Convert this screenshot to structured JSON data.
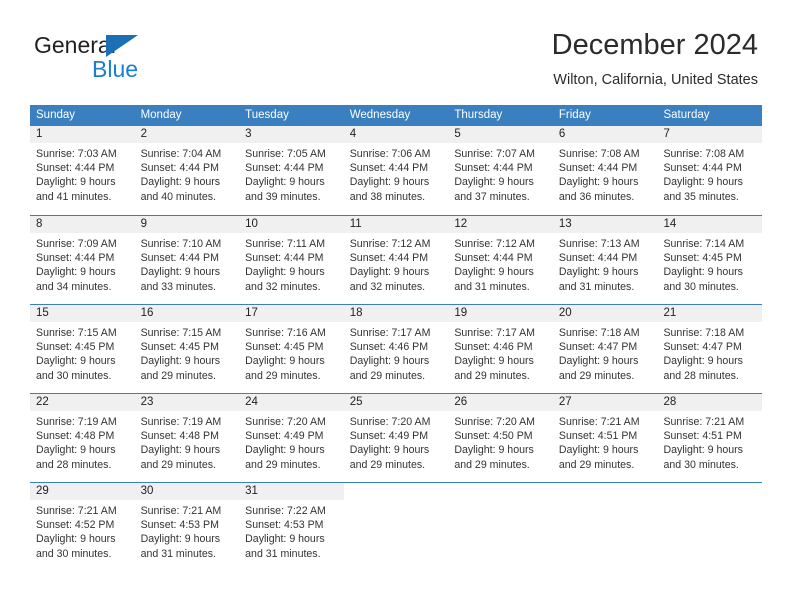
{
  "logo": {
    "word_one": "General",
    "word_two": "Blue",
    "triangle_icon": "blue-triangle-icon",
    "brand_color": "#1a7fd4"
  },
  "header": {
    "title": "December 2024",
    "subtitle": "Wilton, California, United States"
  },
  "calendar": {
    "header_color": "#3a7fbf",
    "weekdays": [
      "Sunday",
      "Monday",
      "Tuesday",
      "Wednesday",
      "Thursday",
      "Friday",
      "Saturday"
    ],
    "weeks": [
      [
        {
          "day": "1",
          "sunrise": "Sunrise: 7:03 AM",
          "sunset": "Sunset: 4:44 PM",
          "daylight_1": "Daylight: 9 hours",
          "daylight_2": "and 41 minutes."
        },
        {
          "day": "2",
          "sunrise": "Sunrise: 7:04 AM",
          "sunset": "Sunset: 4:44 PM",
          "daylight_1": "Daylight: 9 hours",
          "daylight_2": "and 40 minutes."
        },
        {
          "day": "3",
          "sunrise": "Sunrise: 7:05 AM",
          "sunset": "Sunset: 4:44 PM",
          "daylight_1": "Daylight: 9 hours",
          "daylight_2": "and 39 minutes."
        },
        {
          "day": "4",
          "sunrise": "Sunrise: 7:06 AM",
          "sunset": "Sunset: 4:44 PM",
          "daylight_1": "Daylight: 9 hours",
          "daylight_2": "and 38 minutes."
        },
        {
          "day": "5",
          "sunrise": "Sunrise: 7:07 AM",
          "sunset": "Sunset: 4:44 PM",
          "daylight_1": "Daylight: 9 hours",
          "daylight_2": "and 37 minutes."
        },
        {
          "day": "6",
          "sunrise": "Sunrise: 7:08 AM",
          "sunset": "Sunset: 4:44 PM",
          "daylight_1": "Daylight: 9 hours",
          "daylight_2": "and 36 minutes."
        },
        {
          "day": "7",
          "sunrise": "Sunrise: 7:08 AM",
          "sunset": "Sunset: 4:44 PM",
          "daylight_1": "Daylight: 9 hours",
          "daylight_2": "and 35 minutes."
        }
      ],
      [
        {
          "day": "8",
          "sunrise": "Sunrise: 7:09 AM",
          "sunset": "Sunset: 4:44 PM",
          "daylight_1": "Daylight: 9 hours",
          "daylight_2": "and 34 minutes."
        },
        {
          "day": "9",
          "sunrise": "Sunrise: 7:10 AM",
          "sunset": "Sunset: 4:44 PM",
          "daylight_1": "Daylight: 9 hours",
          "daylight_2": "and 33 minutes."
        },
        {
          "day": "10",
          "sunrise": "Sunrise: 7:11 AM",
          "sunset": "Sunset: 4:44 PM",
          "daylight_1": "Daylight: 9 hours",
          "daylight_2": "and 32 minutes."
        },
        {
          "day": "11",
          "sunrise": "Sunrise: 7:12 AM",
          "sunset": "Sunset: 4:44 PM",
          "daylight_1": "Daylight: 9 hours",
          "daylight_2": "and 32 minutes."
        },
        {
          "day": "12",
          "sunrise": "Sunrise: 7:12 AM",
          "sunset": "Sunset: 4:44 PM",
          "daylight_1": "Daylight: 9 hours",
          "daylight_2": "and 31 minutes."
        },
        {
          "day": "13",
          "sunrise": "Sunrise: 7:13 AM",
          "sunset": "Sunset: 4:44 PM",
          "daylight_1": "Daylight: 9 hours",
          "daylight_2": "and 31 minutes."
        },
        {
          "day": "14",
          "sunrise": "Sunrise: 7:14 AM",
          "sunset": "Sunset: 4:45 PM",
          "daylight_1": "Daylight: 9 hours",
          "daylight_2": "and 30 minutes."
        }
      ],
      [
        {
          "day": "15",
          "sunrise": "Sunrise: 7:15 AM",
          "sunset": "Sunset: 4:45 PM",
          "daylight_1": "Daylight: 9 hours",
          "daylight_2": "and 30 minutes."
        },
        {
          "day": "16",
          "sunrise": "Sunrise: 7:15 AM",
          "sunset": "Sunset: 4:45 PM",
          "daylight_1": "Daylight: 9 hours",
          "daylight_2": "and 29 minutes."
        },
        {
          "day": "17",
          "sunrise": "Sunrise: 7:16 AM",
          "sunset": "Sunset: 4:45 PM",
          "daylight_1": "Daylight: 9 hours",
          "daylight_2": "and 29 minutes."
        },
        {
          "day": "18",
          "sunrise": "Sunrise: 7:17 AM",
          "sunset": "Sunset: 4:46 PM",
          "daylight_1": "Daylight: 9 hours",
          "daylight_2": "and 29 minutes."
        },
        {
          "day": "19",
          "sunrise": "Sunrise: 7:17 AM",
          "sunset": "Sunset: 4:46 PM",
          "daylight_1": "Daylight: 9 hours",
          "daylight_2": "and 29 minutes."
        },
        {
          "day": "20",
          "sunrise": "Sunrise: 7:18 AM",
          "sunset": "Sunset: 4:47 PM",
          "daylight_1": "Daylight: 9 hours",
          "daylight_2": "and 29 minutes."
        },
        {
          "day": "21",
          "sunrise": "Sunrise: 7:18 AM",
          "sunset": "Sunset: 4:47 PM",
          "daylight_1": "Daylight: 9 hours",
          "daylight_2": "and 28 minutes."
        }
      ],
      [
        {
          "day": "22",
          "sunrise": "Sunrise: 7:19 AM",
          "sunset": "Sunset: 4:48 PM",
          "daylight_1": "Daylight: 9 hours",
          "daylight_2": "and 28 minutes."
        },
        {
          "day": "23",
          "sunrise": "Sunrise: 7:19 AM",
          "sunset": "Sunset: 4:48 PM",
          "daylight_1": "Daylight: 9 hours",
          "daylight_2": "and 29 minutes."
        },
        {
          "day": "24",
          "sunrise": "Sunrise: 7:20 AM",
          "sunset": "Sunset: 4:49 PM",
          "daylight_1": "Daylight: 9 hours",
          "daylight_2": "and 29 minutes."
        },
        {
          "day": "25",
          "sunrise": "Sunrise: 7:20 AM",
          "sunset": "Sunset: 4:49 PM",
          "daylight_1": "Daylight: 9 hours",
          "daylight_2": "and 29 minutes."
        },
        {
          "day": "26",
          "sunrise": "Sunrise: 7:20 AM",
          "sunset": "Sunset: 4:50 PM",
          "daylight_1": "Daylight: 9 hours",
          "daylight_2": "and 29 minutes."
        },
        {
          "day": "27",
          "sunrise": "Sunrise: 7:21 AM",
          "sunset": "Sunset: 4:51 PM",
          "daylight_1": "Daylight: 9 hours",
          "daylight_2": "and 29 minutes."
        },
        {
          "day": "28",
          "sunrise": "Sunrise: 7:21 AM",
          "sunset": "Sunset: 4:51 PM",
          "daylight_1": "Daylight: 9 hours",
          "daylight_2": "and 30 minutes."
        }
      ],
      [
        {
          "day": "29",
          "sunrise": "Sunrise: 7:21 AM",
          "sunset": "Sunset: 4:52 PM",
          "daylight_1": "Daylight: 9 hours",
          "daylight_2": "and 30 minutes."
        },
        {
          "day": "30",
          "sunrise": "Sunrise: 7:21 AM",
          "sunset": "Sunset: 4:53 PM",
          "daylight_1": "Daylight: 9 hours",
          "daylight_2": "and 31 minutes."
        },
        {
          "day": "31",
          "sunrise": "Sunrise: 7:22 AM",
          "sunset": "Sunset: 4:53 PM",
          "daylight_1": "Daylight: 9 hours",
          "daylight_2": "and 31 minutes."
        },
        {
          "day": "",
          "sunrise": "",
          "sunset": "",
          "daylight_1": "",
          "daylight_2": ""
        },
        {
          "day": "",
          "sunrise": "",
          "sunset": "",
          "daylight_1": "",
          "daylight_2": ""
        },
        {
          "day": "",
          "sunrise": "",
          "sunset": "",
          "daylight_1": "",
          "daylight_2": ""
        },
        {
          "day": "",
          "sunrise": "",
          "sunset": "",
          "daylight_1": "",
          "daylight_2": ""
        }
      ]
    ]
  }
}
